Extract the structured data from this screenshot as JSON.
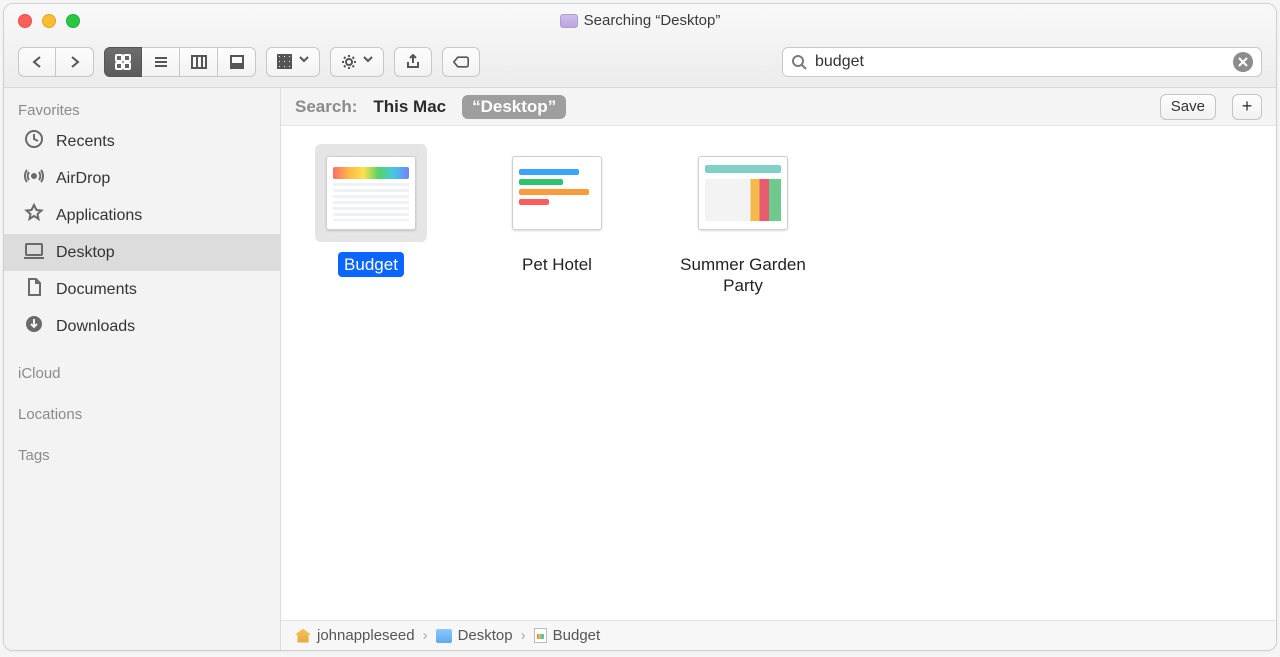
{
  "title": "Searching “Desktop”",
  "search": {
    "value": "budget"
  },
  "scope": {
    "label": "Search:",
    "this_mac": "This Mac",
    "desktop": "“Desktop”",
    "save": "Save"
  },
  "sidebar": {
    "sections": [
      {
        "header": "Favorites",
        "items": [
          {
            "label": "Recents",
            "icon": "recents"
          },
          {
            "label": "AirDrop",
            "icon": "airdrop"
          },
          {
            "label": "Applications",
            "icon": "applications"
          },
          {
            "label": "Desktop",
            "icon": "desktop",
            "selected": true
          },
          {
            "label": "Documents",
            "icon": "documents"
          },
          {
            "label": "Downloads",
            "icon": "downloads"
          }
        ]
      },
      {
        "header": "iCloud",
        "items": []
      },
      {
        "header": "Locations",
        "items": []
      },
      {
        "header": "Tags",
        "items": []
      }
    ]
  },
  "results": [
    {
      "name": "Budget",
      "art": "budget",
      "selected": true
    },
    {
      "name": "Pet Hotel",
      "art": "pet"
    },
    {
      "name": "Summer Garden Party",
      "art": "party"
    }
  ],
  "path": [
    {
      "label": "johnappleseed",
      "icon": "home"
    },
    {
      "label": "Desktop",
      "icon": "folder"
    },
    {
      "label": "Budget",
      "icon": "doc"
    }
  ]
}
